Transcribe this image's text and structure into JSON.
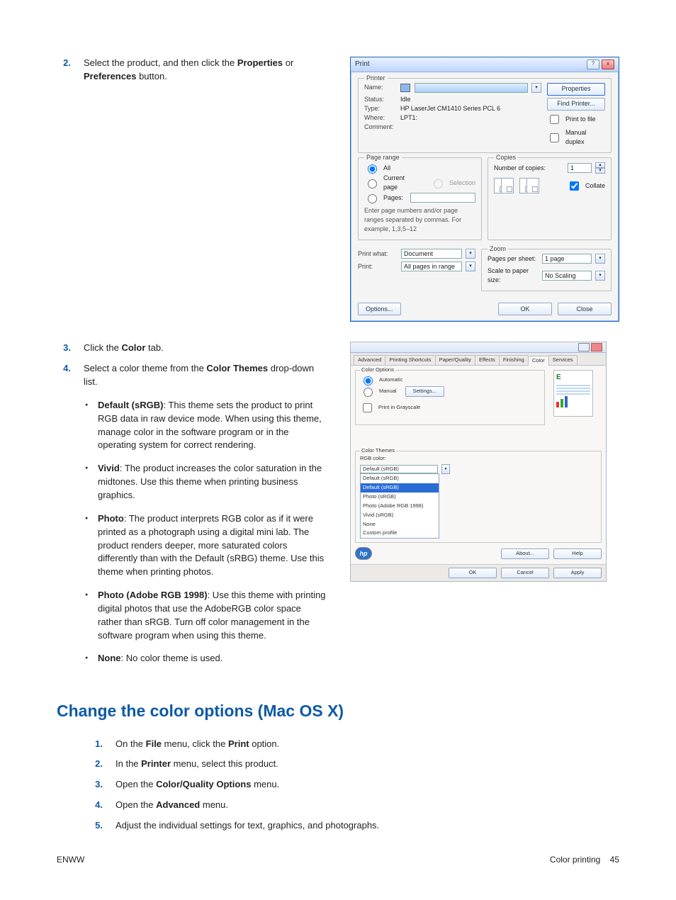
{
  "steps_top": {
    "n2": "2.",
    "t2a": "Select the product, and then click the ",
    "t2b": "Properties",
    "t2c": " or ",
    "t2d": "Preferences",
    "t2e": " button."
  },
  "steps_mid": {
    "n3": "3.",
    "t3a": "Click the ",
    "t3b": "Color",
    "t3c": " tab.",
    "n4": "4.",
    "t4a": "Select a color theme from the ",
    "t4b": "Color Themes",
    "t4c": " drop-down list."
  },
  "bullets": {
    "b1a": "Default (sRGB)",
    "b1b": ": This theme sets the product to print RGB data in raw device mode. When using this theme, manage color in the software program or in the operating system for correct rendering.",
    "b2a": "Vivid",
    "b2b": ": The product increases the color saturation in the midtones. Use this theme when printing business graphics.",
    "b3a": "Photo",
    "b3b": ": The product interprets RGB color as if it were printed as a photograph using a digital mini lab. The product renders deeper, more saturated colors differently than with the Default (sRBG) theme. Use this theme when printing photos.",
    "b4a": "Photo (Adobe RGB 1998)",
    "b4b": ": Use this theme with printing digital photos that use the AdobeRGB color space rather than sRGB. Turn off color management in the software program when using this theme.",
    "b5a": "None",
    "b5b": ": No color theme is used."
  },
  "heading": "Change the color options (Mac OS X)",
  "mac_steps": {
    "n1": "1.",
    "t1a": "On the ",
    "t1b": "File",
    "t1c": " menu, click the ",
    "t1d": "Print",
    "t1e": " option.",
    "n2": "2.",
    "t2a": "In the ",
    "t2b": "Printer",
    "t2c": " menu, select this product.",
    "n3": "3.",
    "t3a": "Open the ",
    "t3b": "Color/Quality Options",
    "t3c": " menu.",
    "n4": "4.",
    "t4a": "Open the ",
    "t4b": "Advanced",
    "t4c": " menu.",
    "n5": "5.",
    "t5": "Adjust the individual settings for text, graphics, and photographs."
  },
  "footer": {
    "left": "ENWW",
    "right_label": "Color printing",
    "page": "45"
  },
  "print_dialog": {
    "title": "Print",
    "printer_group": "Printer",
    "labels": {
      "name": "Name:",
      "status": "Status:",
      "type": "Type:",
      "where": "Where:",
      "comment": "Comment:"
    },
    "vals": {
      "status": "Idle",
      "type": "HP LaserJet CM1410 Series PCL 6",
      "where": "LPT1:",
      "comment": ""
    },
    "btn_properties": "Properties",
    "btn_find": "Find Printer...",
    "chk_print_to_file": "Print to file",
    "chk_manual_duplex": "Manual duplex",
    "page_range_group": "Page range",
    "r_all": "All",
    "r_current": "Current page",
    "r_selection": "Selection",
    "r_pages": "Pages:",
    "pages_hint": "Enter page numbers and/or page ranges separated by commas.  For example, 1,3,5–12",
    "copies_group": "Copies",
    "copies_label": "Number of copies:",
    "copies_value": "1",
    "chk_collate": "Collate",
    "print_what_label": "Print what:",
    "print_what_value": "Document",
    "print_label": "Print:",
    "print_value": "All pages in range",
    "zoom_group": "Zoom",
    "pps_label": "Pages per sheet:",
    "pps_value": "1 page",
    "sts_label": "Scale to paper size:",
    "sts_value": "No Scaling",
    "btn_options": "Options...",
    "btn_ok": "OK",
    "btn_close": "Close"
  },
  "props_dialog": {
    "tabs": [
      "Advanced",
      "Printing Shortcuts",
      "Paper/Quality",
      "Effects",
      "Finishing",
      "Color",
      "Services"
    ],
    "active_tab": "Color",
    "color_options_group": "Color Options",
    "r_automatic": "Automatic",
    "r_manual": "Manual",
    "btn_settings": "Settings...",
    "chk_grayscale": "Print in Grayscale",
    "preview_letter": "E",
    "color_themes_group": "Color Themes",
    "rgb_label": "RGB color:",
    "dd_selected": "Default (sRGB)",
    "dd_items": [
      "Default (sRGB)",
      "Default (sRGB)",
      "Photo (sRGB)",
      "Photo (Adobe RGB 1998)",
      "Vivid (sRGB)",
      "None",
      "Custom profile"
    ],
    "logo": "hp",
    "btn_about": "About...",
    "btn_help": "Help",
    "btn_ok": "OK",
    "btn_cancel": "Cancel",
    "btn_apply": "Apply"
  }
}
